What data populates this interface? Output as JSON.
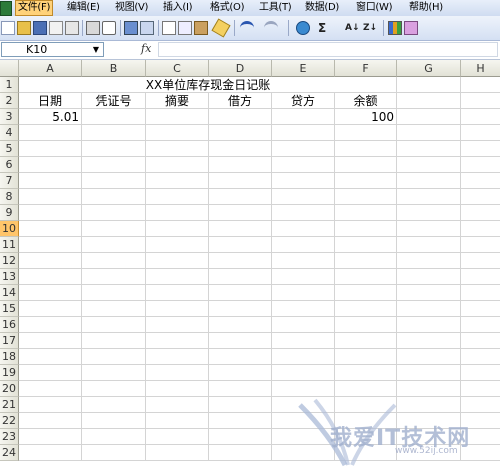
{
  "menu": {
    "items": [
      "文件(F)",
      "编辑(E)",
      "视图(V)",
      "插入(I)",
      "格式(O)",
      "工具(T)",
      "数据(D)",
      "窗口(W)",
      "帮助(H)"
    ]
  },
  "toolbar": {
    "sigma": "Σ",
    "sort_asc": "A↓",
    "sort_desc": "Z↓"
  },
  "formula_bar": {
    "name_box": "K10",
    "fx": "fx",
    "value": ""
  },
  "sheet": {
    "columns": [
      "A",
      "B",
      "C",
      "D",
      "E",
      "F",
      "G",
      "H"
    ],
    "rows": [
      "1",
      "2",
      "3",
      "4",
      "5",
      "6",
      "7",
      "8",
      "9",
      "10",
      "11",
      "12",
      "13",
      "14",
      "15",
      "16",
      "17",
      "18",
      "19",
      "20",
      "21",
      "22",
      "23",
      "24"
    ],
    "active_row": "10",
    "title": "XX单位库存现金日记账",
    "headers": [
      "日期",
      "凭证号",
      "摘要",
      "借方",
      "贷方",
      "余额"
    ],
    "row3": {
      "A": "5.01",
      "F": "100"
    }
  },
  "watermark": {
    "text": "我爱IT技术网",
    "sub": "www.52ij.com"
  },
  "colors": {
    "menu_active": "#ffd27a",
    "row_active": "#ffc56a"
  }
}
